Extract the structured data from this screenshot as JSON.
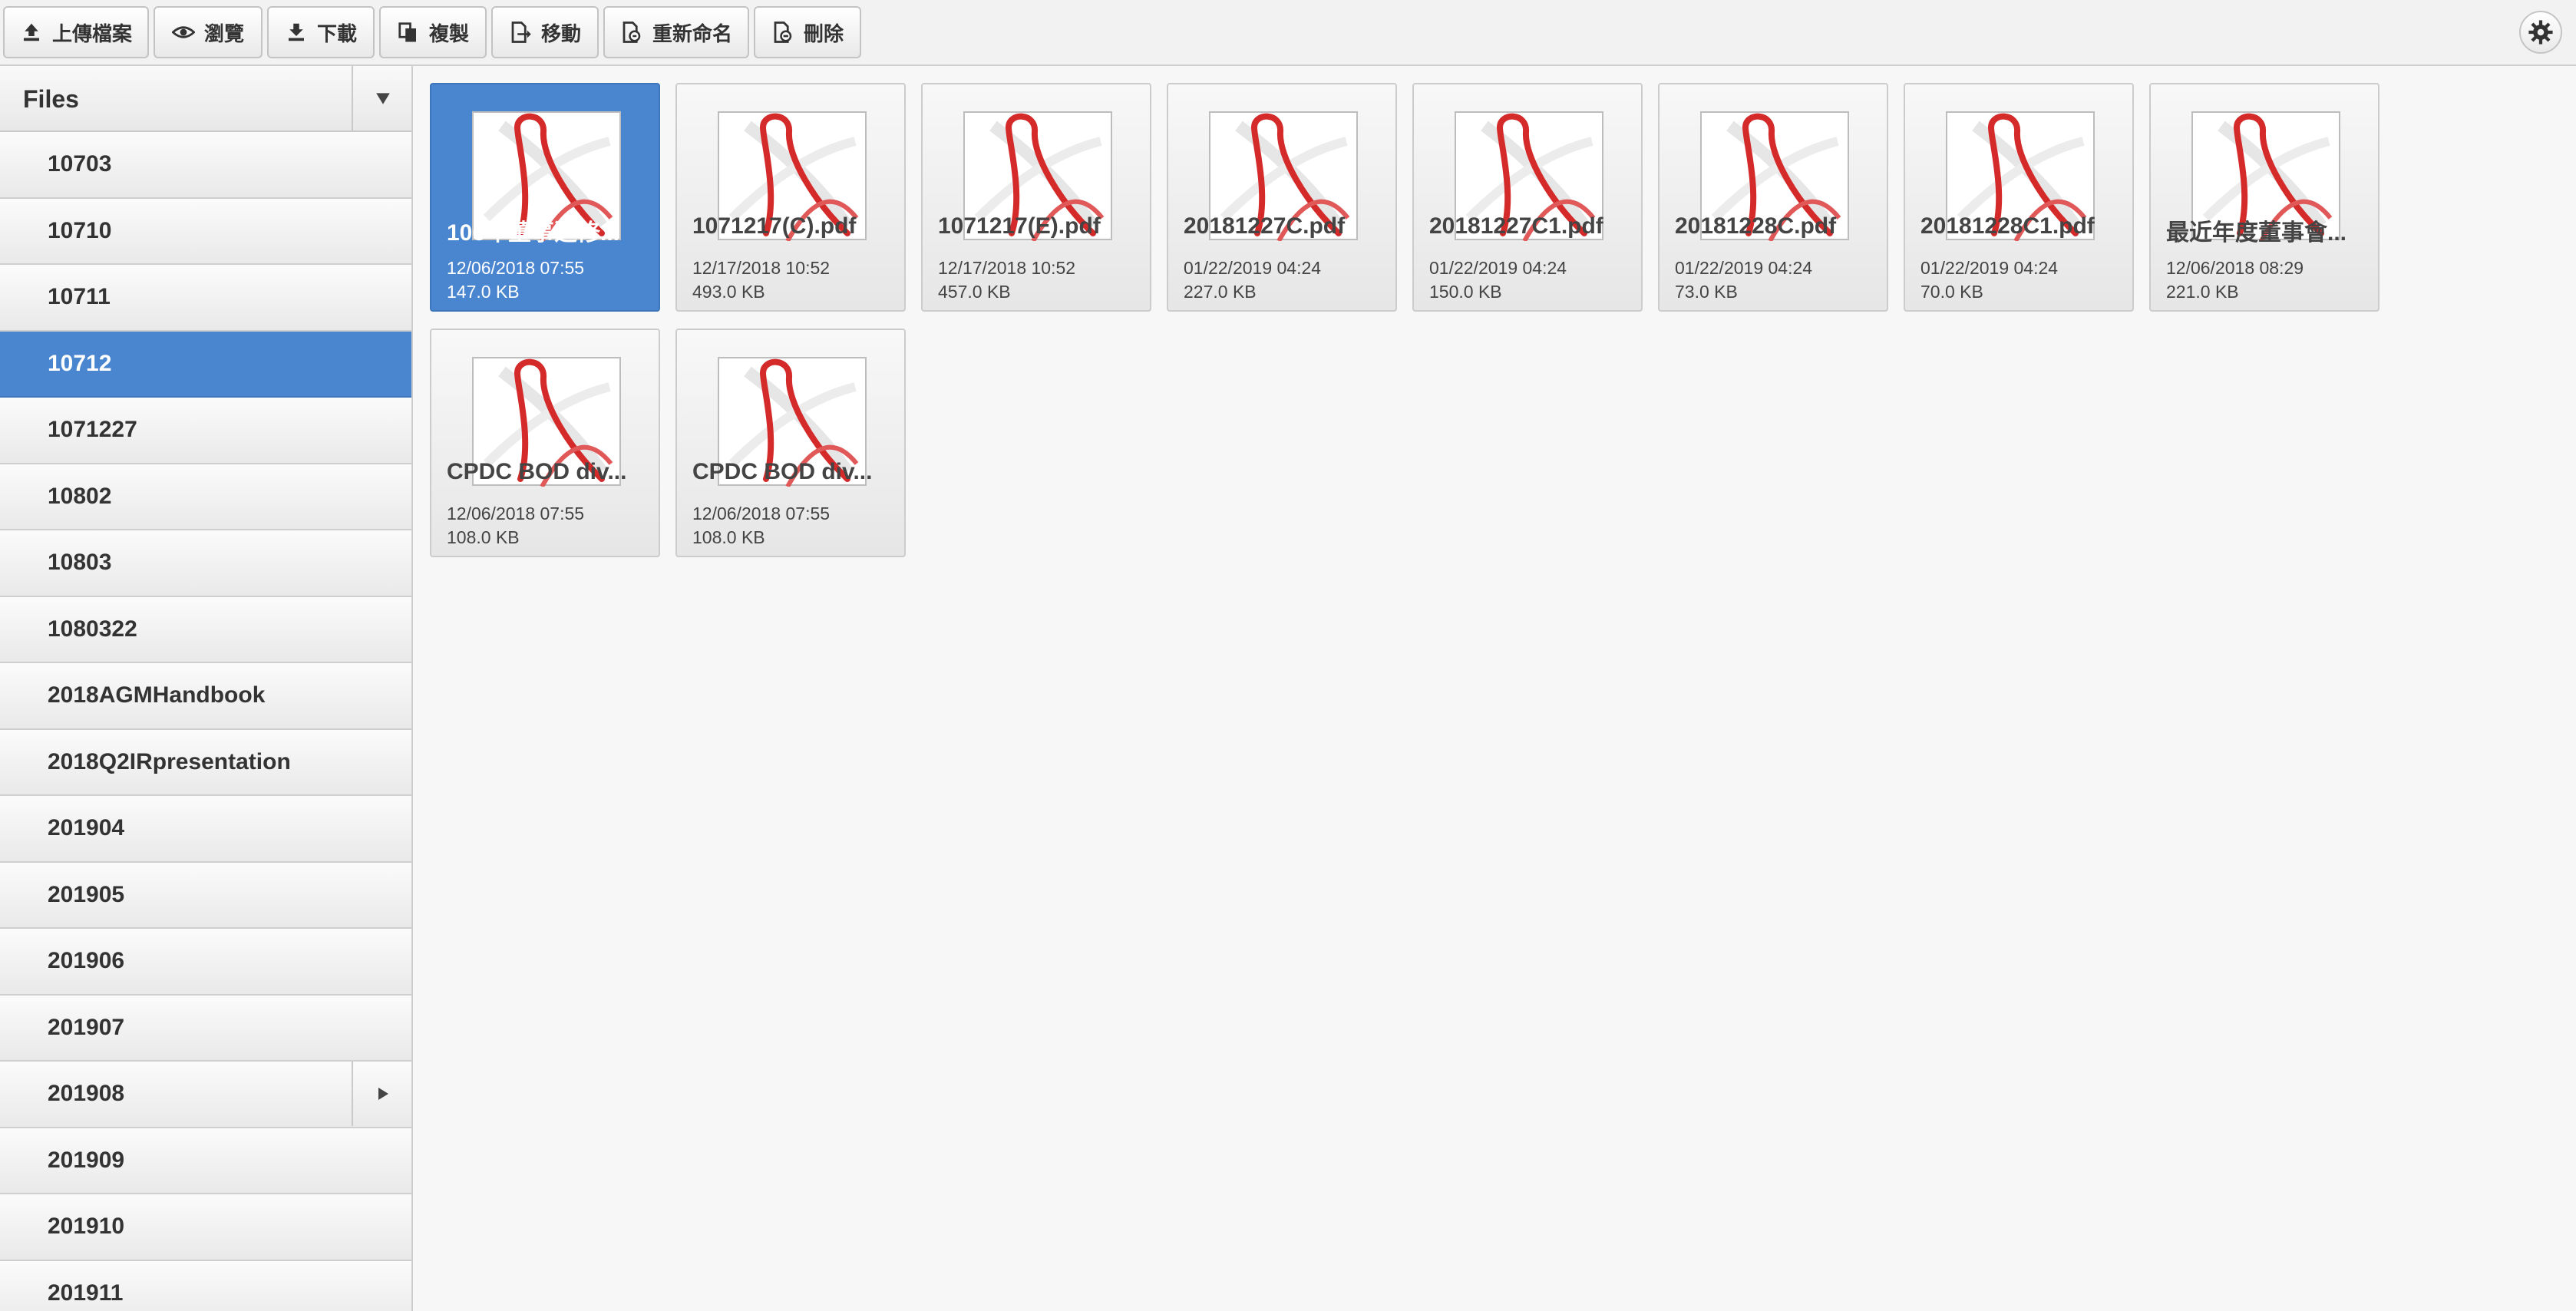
{
  "toolbar": {
    "upload": "上傳檔案",
    "view": "瀏覽",
    "download": "下載",
    "copy": "複製",
    "move": "移動",
    "rename": "重新命名",
    "delete": "刪除"
  },
  "sidebar": {
    "title": "Files",
    "items": [
      {
        "label": "10703"
      },
      {
        "label": "10710"
      },
      {
        "label": "10711"
      },
      {
        "label": "10712",
        "selected": true
      },
      {
        "label": "1071227"
      },
      {
        "label": "10802"
      },
      {
        "label": "10803"
      },
      {
        "label": "1080322"
      },
      {
        "label": "2018AGMHandbook"
      },
      {
        "label": "2018Q2IRpresentation"
      },
      {
        "label": "201904"
      },
      {
        "label": "201905"
      },
      {
        "label": "201906"
      },
      {
        "label": "201907"
      },
      {
        "label": "201908",
        "has_children": true
      },
      {
        "label": "201909"
      },
      {
        "label": "201910"
      },
      {
        "label": "201911"
      }
    ]
  },
  "files": [
    {
      "name": "106年董事進修...",
      "date": "12/06/2018 07:55",
      "size": "147.0 KB",
      "selected": true
    },
    {
      "name": "1071217(C).pdf",
      "date": "12/17/2018 10:52",
      "size": "493.0 KB"
    },
    {
      "name": "1071217(E).pdf",
      "date": "12/17/2018 10:52",
      "size": "457.0 KB"
    },
    {
      "name": "20181227C.pdf",
      "date": "01/22/2019 04:24",
      "size": "227.0 KB"
    },
    {
      "name": "20181227C1.pdf",
      "date": "01/22/2019 04:24",
      "size": "150.0 KB"
    },
    {
      "name": "20181228C.pdf",
      "date": "01/22/2019 04:24",
      "size": "73.0 KB"
    },
    {
      "name": "20181228C1.pdf",
      "date": "01/22/2019 04:24",
      "size": "70.0 KB"
    },
    {
      "name": "最近年度董事會...",
      "date": "12/06/2018 08:29",
      "size": "221.0 KB"
    },
    {
      "name": "CPDC BOD div...",
      "date": "12/06/2018 07:55",
      "size": "108.0 KB"
    },
    {
      "name": "CPDC BOD div...",
      "date": "12/06/2018 07:55",
      "size": "108.0 KB"
    }
  ],
  "icons": {
    "upload": "upload-icon",
    "view": "eye-icon",
    "download": "download-icon",
    "copy": "copy-icon",
    "move": "move-icon",
    "rename": "rename-icon",
    "delete": "delete-icon",
    "settings": "gear-icon",
    "file_thumb": "pdf-file-icon"
  },
  "colors": {
    "selected": "#4a86cf",
    "pdf_ribbon": "#d42a2a"
  }
}
